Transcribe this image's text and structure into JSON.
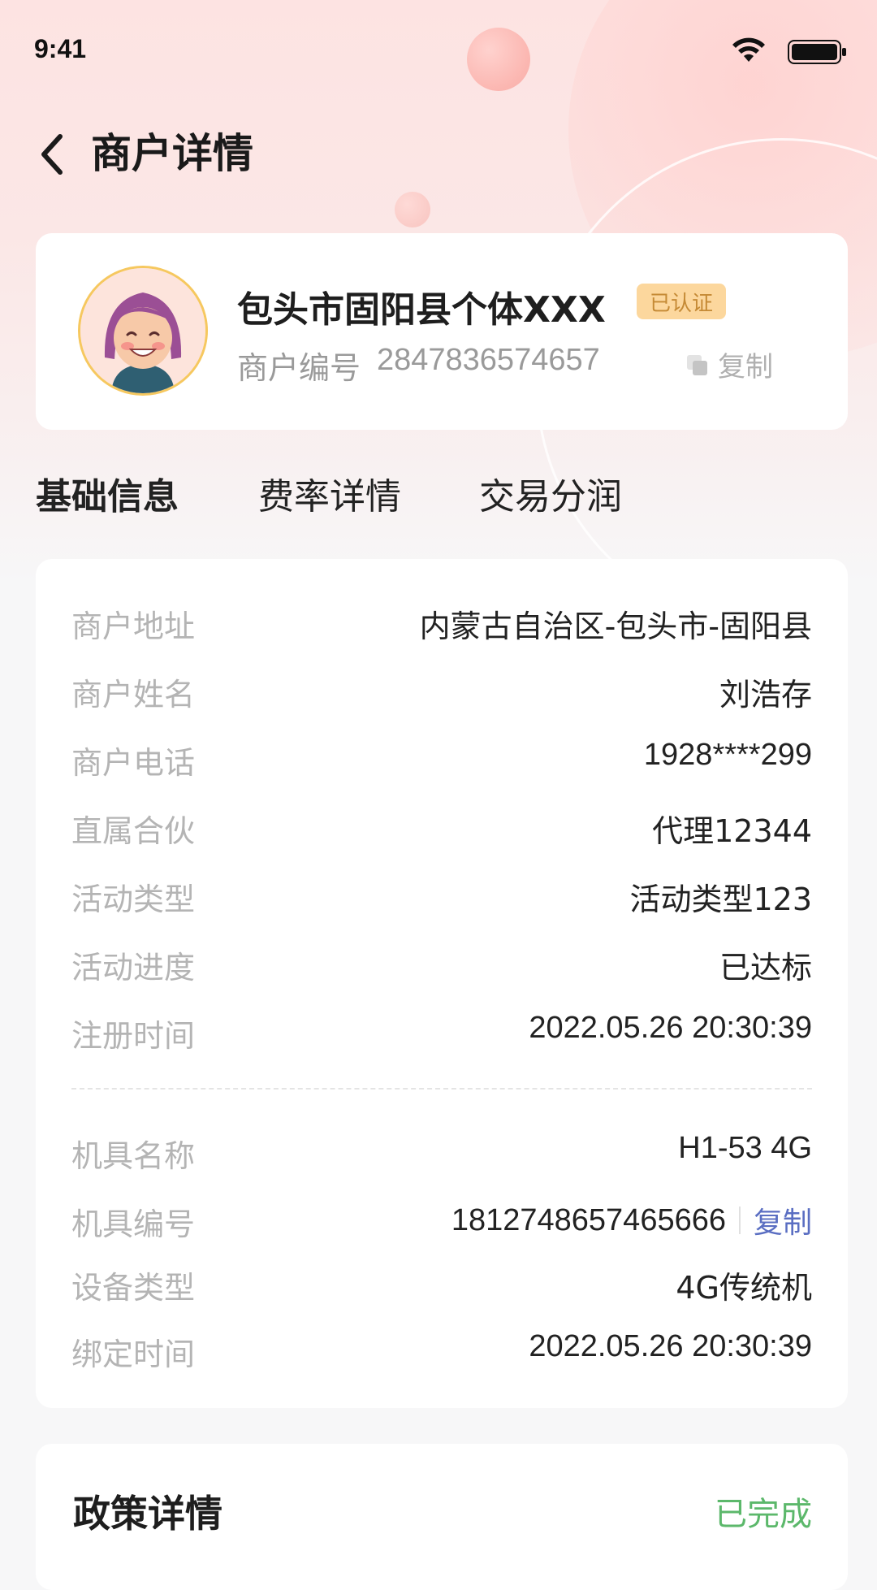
{
  "status_bar": {
    "time": "9:41"
  },
  "nav": {
    "title": "商户详情"
  },
  "merchant": {
    "name": "包头市固阳县个体XXX",
    "badge": "已认证",
    "id_label": "商户编号",
    "id_value": "2847836574657",
    "copy_label": "复制"
  },
  "tabs": [
    {
      "label": "基础信息",
      "active": true
    },
    {
      "label": "费率详情",
      "active": false
    },
    {
      "label": "交易分润",
      "active": false
    }
  ],
  "basic_info": [
    {
      "label": "商户地址",
      "value": "内蒙古自治区-包头市-固阳县"
    },
    {
      "label": "商户姓名",
      "value": "刘浩存"
    },
    {
      "label": "商户电话",
      "value": "1928****299"
    },
    {
      "label": "直属合伙",
      "value": "代理12344"
    },
    {
      "label": "活动类型",
      "value": "活动类型123"
    },
    {
      "label": "活动进度",
      "value": "已达标"
    },
    {
      "label": "注册时间",
      "value": "2022.05.26 20:30:39"
    }
  ],
  "device_info": {
    "name_label": "机具名称",
    "name_value": "H1-53 4G",
    "number_label": "机具编号",
    "number_value": "1812748657465666",
    "number_copy": "复制",
    "type_label": "设备类型",
    "type_value": "4G传统机",
    "bind_label": "绑定时间",
    "bind_value": "2022.05.26 20:30:39"
  },
  "policy": {
    "title": "政策详情",
    "status": "已完成"
  },
  "colors": {
    "accent_red": "#f1463d",
    "badge_bg": "#fcd79d",
    "badge_text": "#c58a35",
    "link_blue": "#5a6ec2",
    "status_green": "#5cb86b"
  }
}
